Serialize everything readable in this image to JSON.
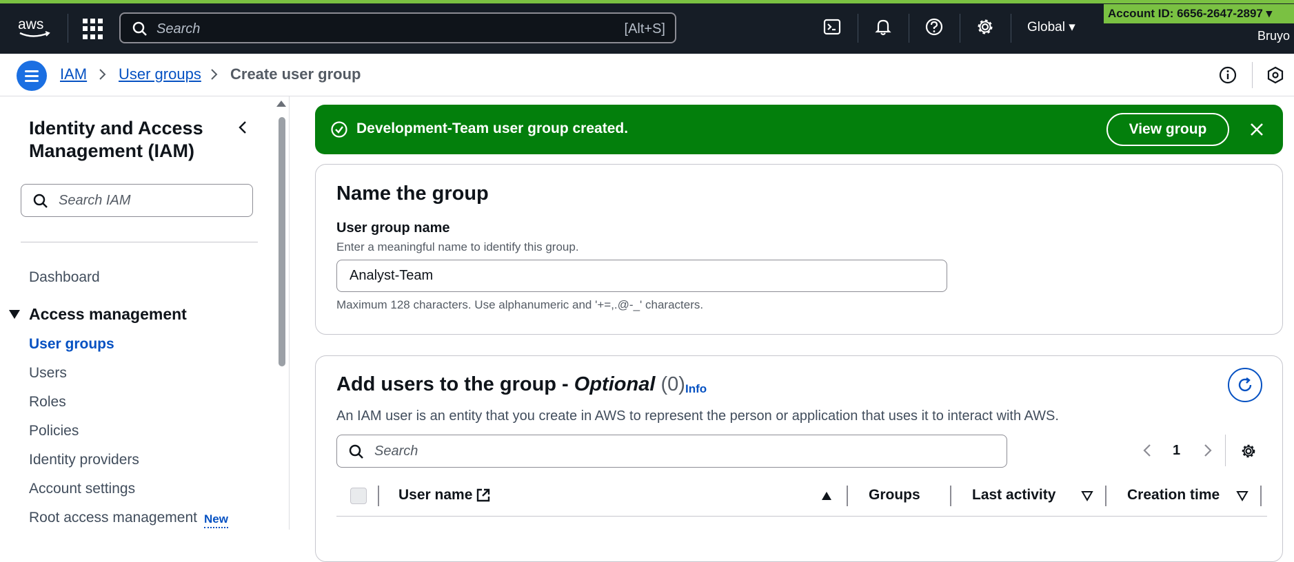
{
  "topnav": {
    "logo": "aws",
    "search_placeholder": "Search",
    "search_shortcut": "[Alt+S]",
    "region": "Global",
    "account": "Account ID: 6656-2647-2897 ▾",
    "user": "Bruyo",
    "icons": [
      "apps-grid-icon",
      "search-icon",
      "cloudshell-icon",
      "bell-icon",
      "help-icon",
      "settings-icon"
    ]
  },
  "breadcrumb": {
    "items": [
      {
        "label": "IAM"
      },
      {
        "label": "User groups"
      },
      {
        "label": "Create user group"
      }
    ]
  },
  "sidebar": {
    "title": "Identity and Access Management (IAM)",
    "search_placeholder": "Search IAM",
    "dashboard": "Dashboard",
    "section": "Access management",
    "items": [
      {
        "label": "User groups"
      },
      {
        "label": "Users"
      },
      {
        "label": "Roles"
      },
      {
        "label": "Policies"
      },
      {
        "label": "Identity providers"
      },
      {
        "label": "Account settings"
      },
      {
        "label": "Root access management"
      }
    ],
    "new_badge": "New"
  },
  "flash": {
    "message": "Development-Team user group created.",
    "button": "View group",
    "color": "#037f0c"
  },
  "name_panel": {
    "title": "Name the group",
    "field_label": "User group name",
    "field_desc": "Enter a meaningful name to identify this group.",
    "field_value": "Analyst-Team",
    "constraint": "Maximum 128 characters. Use alphanumeric and '+=,.@-_' characters."
  },
  "users_panel": {
    "title_main": "Add users to the group - ",
    "title_optional": "Optional",
    "count": "(0)",
    "info": "Info",
    "description": "An IAM user is an entity that you create in AWS to represent the person or application that uses it to interact with AWS.",
    "search_placeholder": "Search",
    "page": "1",
    "columns": [
      "User name",
      "Groups",
      "Last activity",
      "Creation time"
    ]
  },
  "colors": {
    "topbar": "#161d26",
    "accent": "#7ac142",
    "link": "#0551c2",
    "primary_button": "#1b6fe2"
  }
}
